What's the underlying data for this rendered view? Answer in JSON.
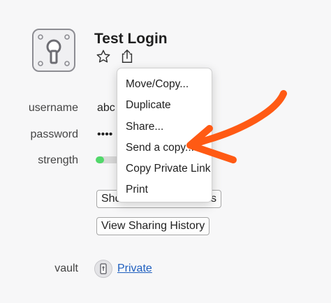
{
  "item": {
    "title": "Test Login",
    "icon": "keyhole-icon"
  },
  "title_actions": [
    {
      "icon": "star-icon"
    },
    {
      "icon": "share-icon"
    }
  ],
  "fields": {
    "username": {
      "label": "username",
      "value": "abc"
    },
    "password": {
      "label": "password",
      "value": "••••"
    },
    "strength": {
      "label": "strength",
      "level": 0.3,
      "color": "#51d86a"
    },
    "vault": {
      "label": "vault",
      "value": "Private",
      "icon": "vault-icon"
    }
  },
  "buttons": {
    "share_partial": "Sho",
    "share_partial_tail": "s",
    "view_sharing_history": "View Sharing History"
  },
  "menu": {
    "items": [
      "Move/Copy...",
      "Duplicate",
      "Share...",
      "Send a copy...",
      "Copy Private Link",
      "Print"
    ]
  },
  "colors": {
    "annotation_arrow": "#ff5a14",
    "link": "#1f5fbf"
  }
}
